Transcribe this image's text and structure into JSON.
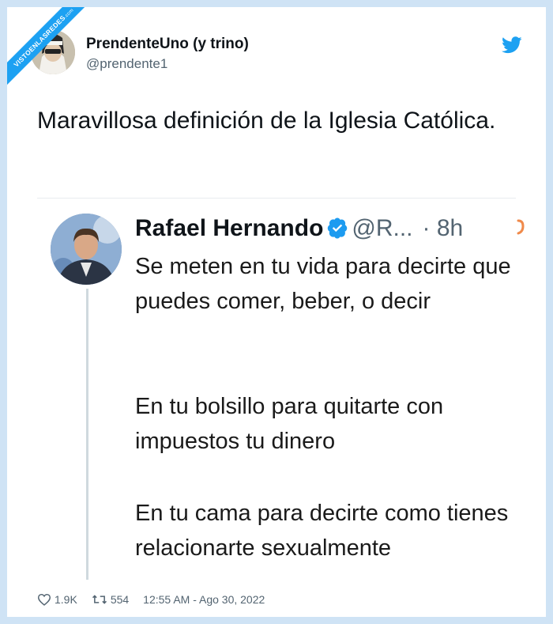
{
  "watermark": {
    "text": "VISTOENLASREDES",
    "suffix": ".com"
  },
  "author": {
    "name": "PrendenteUno (y trino)",
    "handle": "@prendente1"
  },
  "tweet": {
    "text": "Maravillosa definición de la Iglesia Católica."
  },
  "quoted": {
    "name": "Rafael Hernando",
    "handle": "@R...",
    "separator": "·",
    "time": "8h",
    "paragraphs": [
      "Se meten en tu vida para decirte que puedes comer, beber, o decir",
      "En tu bolsillo para quitarte con impuestos tu dinero",
      "En tu cama para decirte como tienes relacionarte sexualmente"
    ]
  },
  "footer": {
    "likes": "1.9K",
    "retweets": "554",
    "timestamp": "12:55 AM - Ago 30, 2022"
  },
  "icons": [
    "twitter-bird-icon",
    "verified-badge-icon",
    "heart-icon",
    "retweet-icon"
  ],
  "colors": {
    "background": "#cfe3f5",
    "twitter_blue": "#1da1f2",
    "verified_blue": "#1d9bf0",
    "muted_text": "#536471"
  }
}
